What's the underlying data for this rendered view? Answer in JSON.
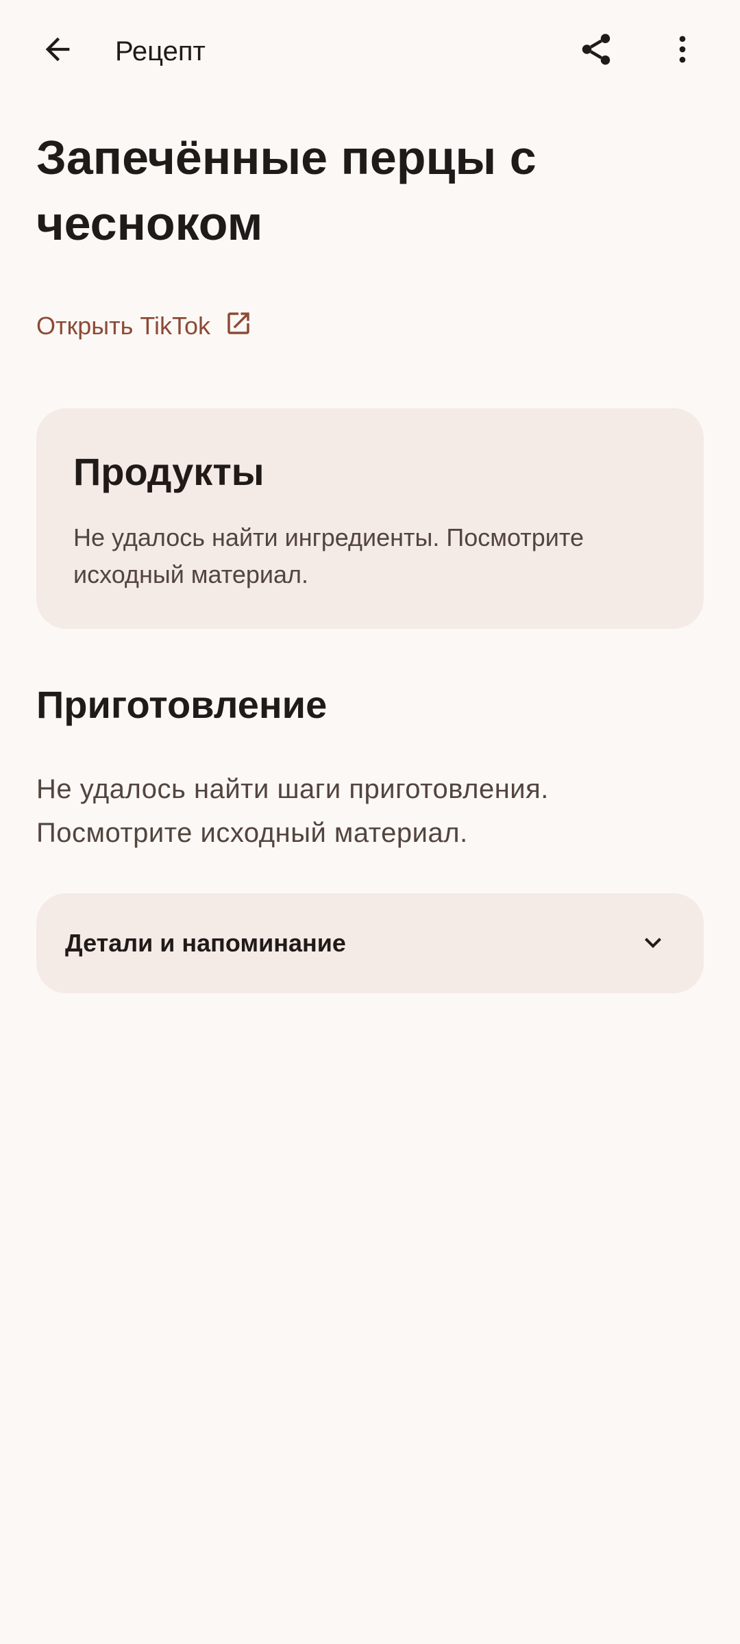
{
  "header": {
    "title": "Рецепт",
    "back_icon": "arrow-back-icon",
    "share_icon": "share-icon",
    "more_icon": "more-vert-icon"
  },
  "recipe": {
    "title": "Запечённые перцы с чесноком",
    "source_link_label": "Открыть TikTok",
    "source_link_icon": "open-in-new-icon"
  },
  "products": {
    "title": "Продукты",
    "empty_text": "Не удалось найти ингредиенты. Посмотрите исходный материал."
  },
  "preparation": {
    "title": "Приготовление",
    "empty_text": "Не удалось найти шаги приготовления. Посмотрите исходный материал."
  },
  "details": {
    "label": "Детали и напоминание",
    "icon": "chevron-down-icon"
  },
  "colors": {
    "background": "#FCF8F5",
    "card": "#F4EAE6",
    "accent": "#8C4A36",
    "text_primary": "#201A18",
    "text_secondary": "#52443F"
  }
}
